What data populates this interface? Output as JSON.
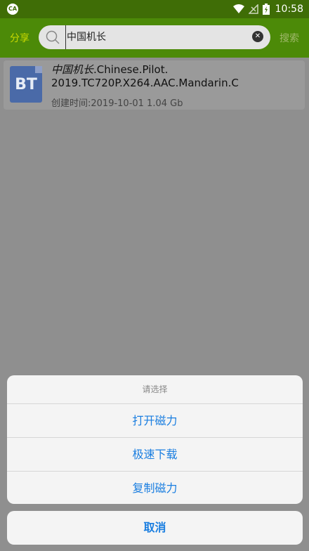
{
  "status_bar": {
    "time": "10:58",
    "app_icon": "app-badge-icon"
  },
  "header": {
    "share_label": "分享",
    "search_value": "中国机长",
    "search_button": "搜索"
  },
  "result": {
    "title_highlight": "中国机长",
    "title_rest": ".Chinese.Pilot.\n2019.TC720P.X264.AAC.Mandarin.C",
    "icon_text": "BT",
    "meta": "创建时间:2019-10-01 1.04 Gb"
  },
  "action_sheet": {
    "title": "请选择",
    "items": [
      {
        "label": "打开磁力"
      },
      {
        "label": "极速下载"
      },
      {
        "label": "复制磁力"
      }
    ],
    "cancel": "取消"
  },
  "colors": {
    "status_bar": "#3f6d06",
    "header": "#4c8a08",
    "accent_text": "#1a7ee0",
    "share": "#c9d900"
  }
}
